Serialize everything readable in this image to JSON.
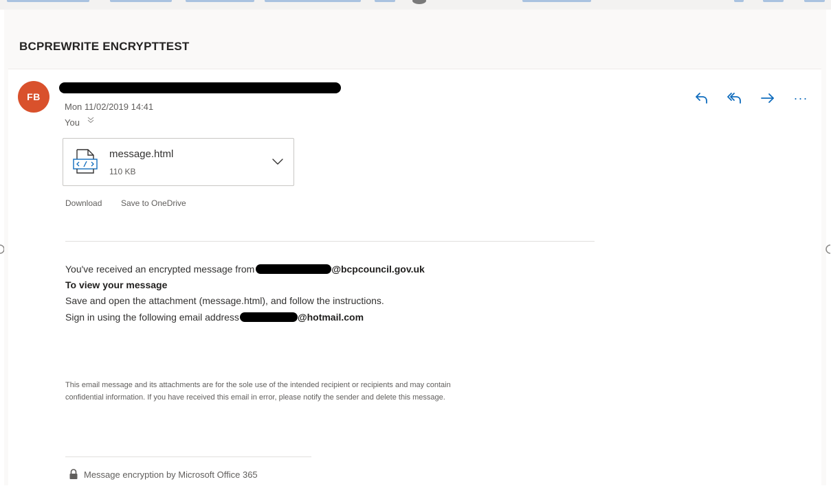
{
  "email": {
    "subject": "BCPREWRITE ENCRYPTTEST",
    "sender_initials": "FB",
    "date": "Mon 11/02/2019 14:41",
    "recipient": "You"
  },
  "actions": {
    "reply": "reply-icon",
    "reply_all": "reply-all-icon",
    "forward": "forward-icon",
    "more": "more-icon",
    "more_label": "···"
  },
  "attachment": {
    "file_name": "message.html",
    "file_size": "110 KB",
    "icon": "html-file-icon"
  },
  "attachment_links": {
    "download": "Download",
    "save_onedrive": "Save to OneDrive"
  },
  "body": {
    "received_prefix": "You've received an encrypted message from",
    "sender_domain": "@bcpcouncil.gov.uk",
    "view_heading": "To view your message",
    "instruction": "Save and open the attachment (message.html), and follow the instructions.",
    "sign_in_prefix": "Sign in using the following email address",
    "sign_in_domain": "@hotmail.com",
    "disclaimer_line1": "This email message and its attachments are for the sole use of the intended recipient or recipients and may contain",
    "disclaimer_line2": "confidential information. If you have received this email in error, please notify the sender and delete this message."
  },
  "footer": {
    "encryption_label": "Message encryption by Microsoft Office 365"
  },
  "colors": {
    "avatar": "#d9512c",
    "action_blue": "#0f6cbd"
  }
}
